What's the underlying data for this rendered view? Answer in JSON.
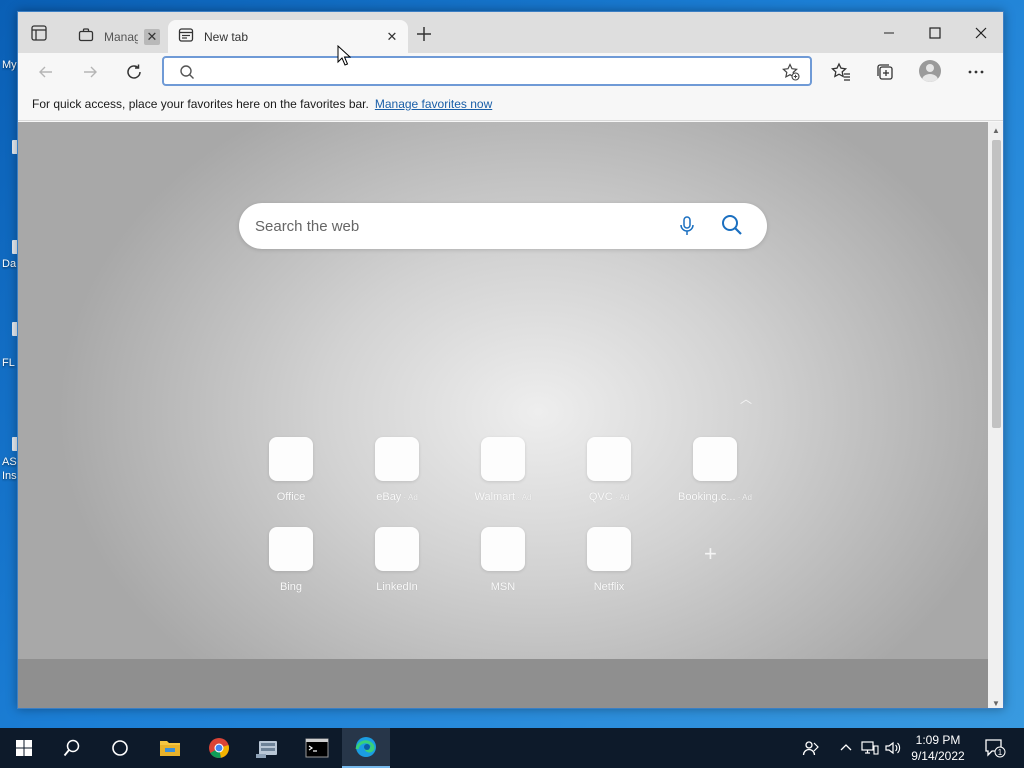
{
  "desktop": {
    "labels": [
      "My",
      "Da",
      "FL",
      "AS",
      "Ins"
    ]
  },
  "browser": {
    "tabs": [
      {
        "title": "Manag",
        "icon": "briefcase-icon"
      },
      {
        "title": "New tab",
        "icon": "newtab-page-icon"
      }
    ],
    "address_bar": {
      "value": "",
      "placeholder": ""
    },
    "favorites_bar": {
      "message": "For quick access, place your favorites here on the favorites bar.",
      "link": "Manage favorites now"
    },
    "new_tab_page": {
      "search_placeholder": "Search the web",
      "tiles_row1": [
        {
          "label": "Office",
          "ad": ""
        },
        {
          "label": "eBay",
          "ad": " · Ad"
        },
        {
          "label": "Walmart",
          "ad": " · Ad"
        },
        {
          "label": "QVC",
          "ad": " · Ad"
        },
        {
          "label": "Booking.c...",
          "ad": " · Ad"
        }
      ],
      "tiles_row2": [
        {
          "label": "Bing"
        },
        {
          "label": "LinkedIn"
        },
        {
          "label": "MSN"
        },
        {
          "label": "Netflix"
        }
      ]
    }
  },
  "taskbar": {
    "apps": [
      "start",
      "search",
      "task-view",
      "file-explorer",
      "chrome",
      "server-manager",
      "cmd",
      "edge"
    ],
    "clock": {
      "time": "1:09 PM",
      "date": "9/14/2022"
    },
    "notification_count": "1"
  },
  "colors": {
    "accent": "#0078d4",
    "taskbar": "#0d1a2a",
    "desktop": "#1c7fd6"
  }
}
